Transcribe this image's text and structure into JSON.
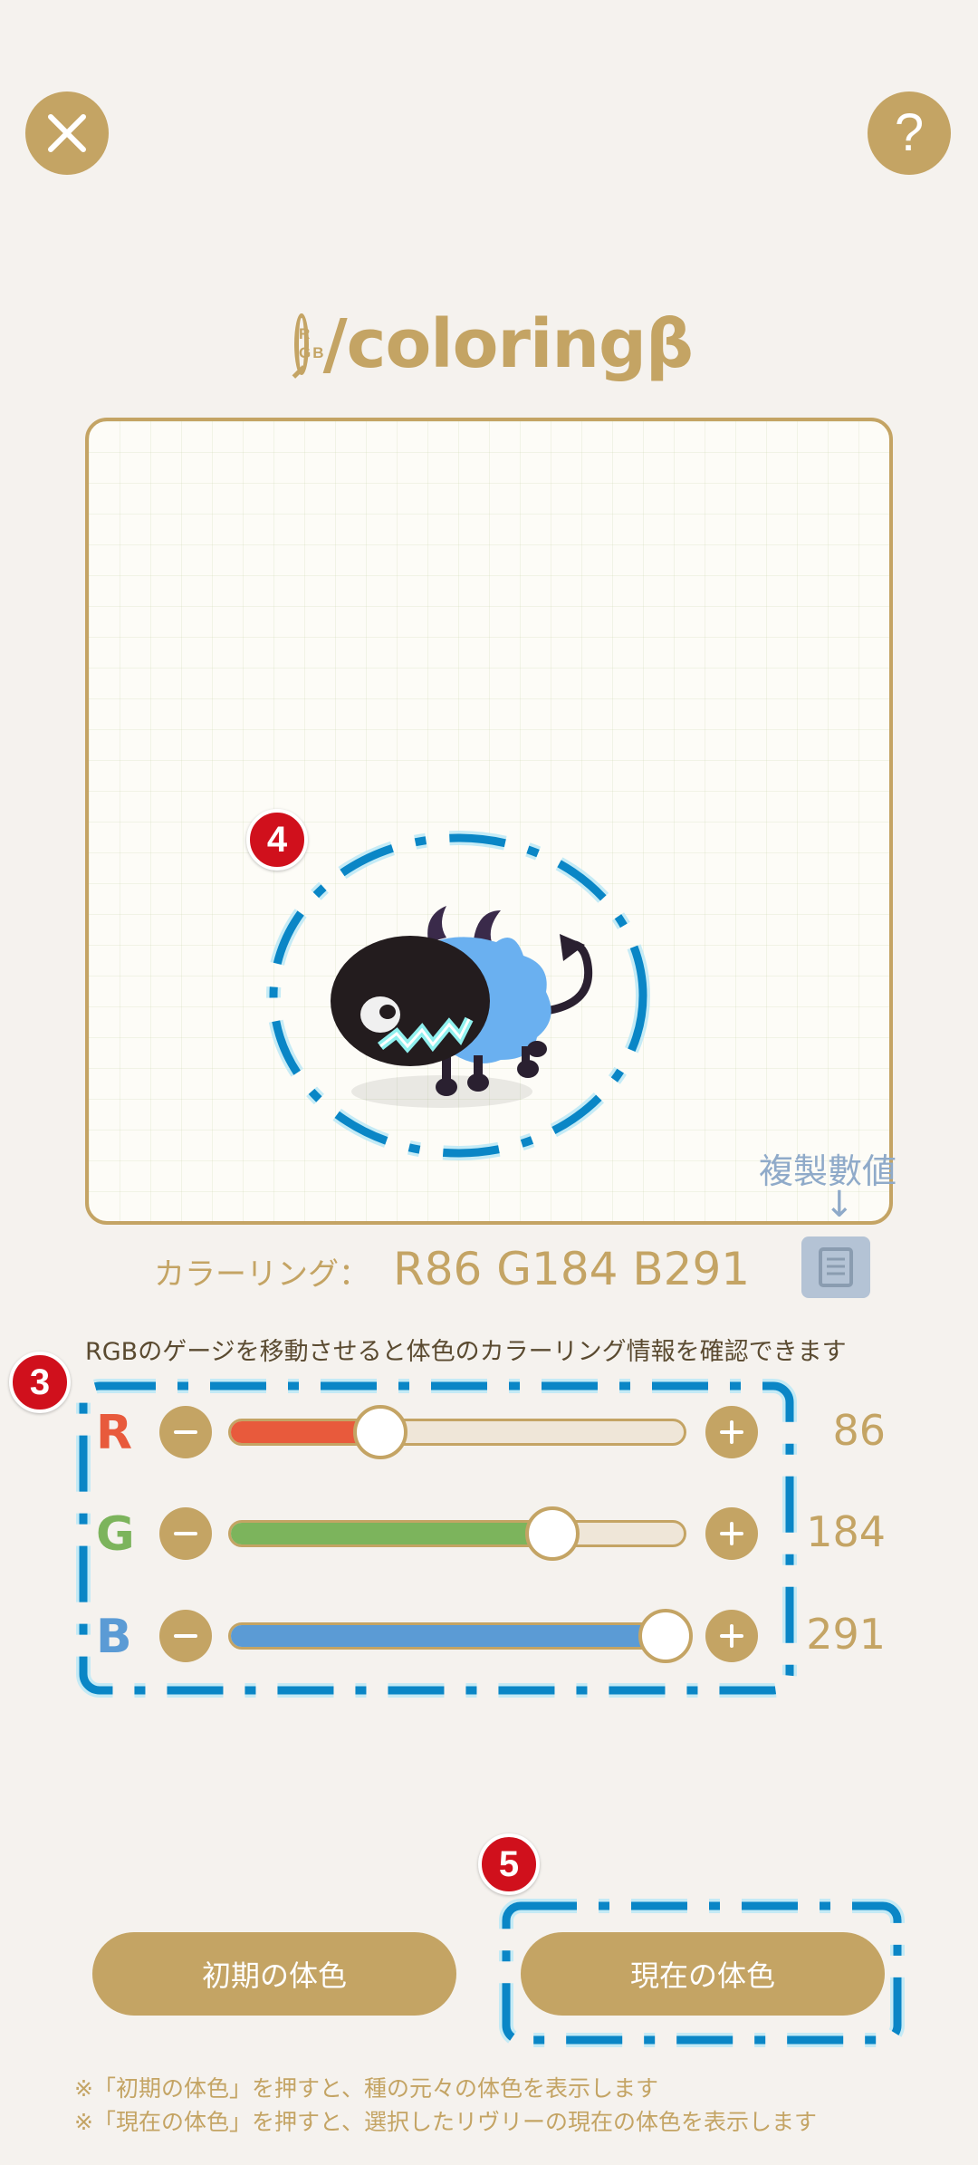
{
  "header": {
    "close_icon": "close-icon",
    "help_label": "?"
  },
  "logo": {
    "mark_top": "R",
    "mark_bottom": "GB",
    "text": "/coloringβ"
  },
  "annotations": {
    "badge_3": "3",
    "badge_4": "4",
    "badge_5": "5",
    "copy_label": "複製數値",
    "copy_arrow": "↓"
  },
  "coloring": {
    "label": "カラーリング：",
    "value": "R86 G184 B291"
  },
  "hint": "RGBのゲージを移動させると体色のカラーリング情報を確認できます",
  "sliders": [
    {
      "channel": "R",
      "value": "86",
      "level": 0.33,
      "color": "#e85a3c",
      "letter_color": "#e85a3c"
    },
    {
      "channel": "G",
      "value": "184",
      "level": 0.71,
      "color": "#7cb45c",
      "letter_color": "#7cb45c"
    },
    {
      "channel": "B",
      "value": "291",
      "level": 0.96,
      "color": "#5b9bd5",
      "letter_color": "#5b9bd5"
    }
  ],
  "buttons": {
    "initial": "初期の体色",
    "current": "現在の体色"
  },
  "notes": [
    "※「初期の体色」を押すと、種の元々の体色を表示します",
    "※「現在の体色」を押すと、選択したリヴリーの現在の体色を表示します"
  ],
  "colors": {
    "accent": "#c4a464",
    "background": "#f5f2ee",
    "highlight": "#0a86c6",
    "badge": "#d0101c"
  }
}
